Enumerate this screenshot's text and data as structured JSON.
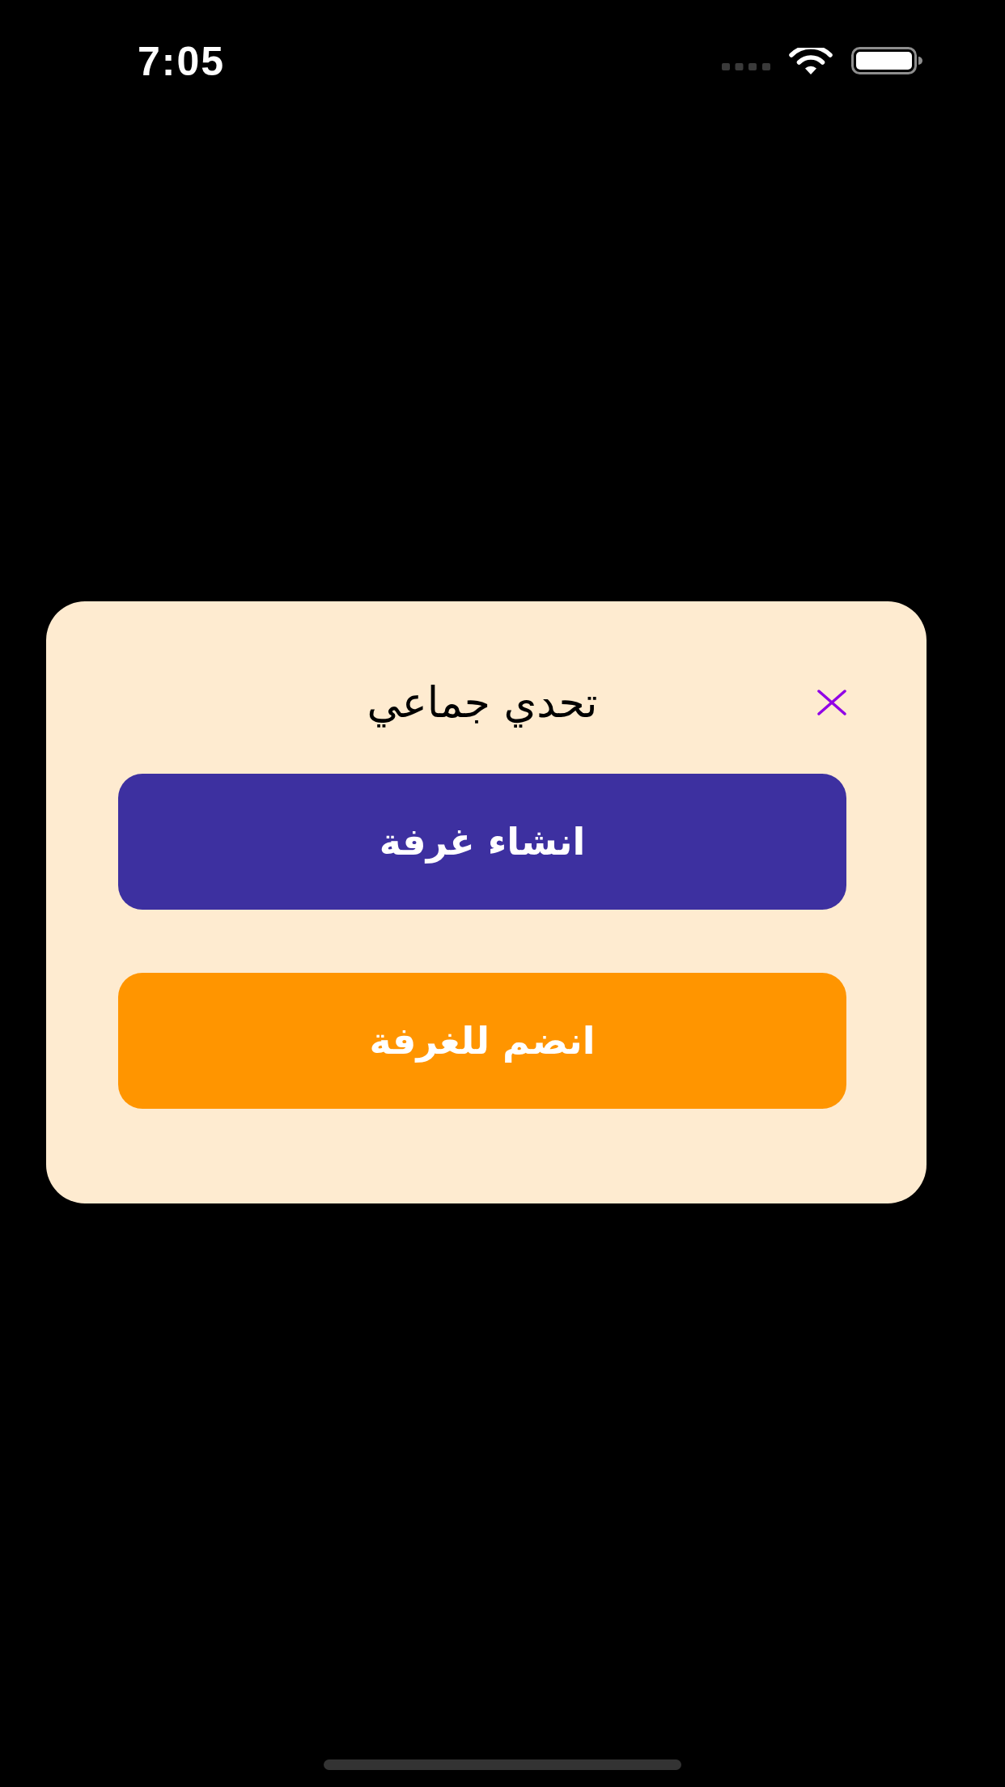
{
  "status_bar": {
    "time": "7:05"
  },
  "dialog": {
    "title": "تحدي جماعي",
    "buttons": [
      {
        "label": "انشاء غرفة",
        "kind": "primary"
      },
      {
        "label": "انضم للغرفة",
        "kind": "secondary"
      }
    ]
  }
}
